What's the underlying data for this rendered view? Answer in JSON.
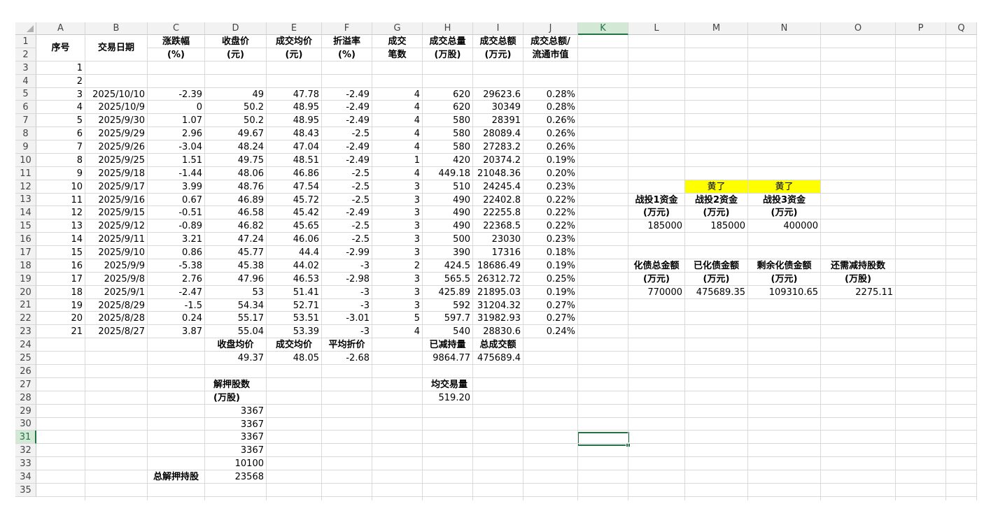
{
  "columns": [
    "A",
    "B",
    "C",
    "D",
    "E",
    "F",
    "G",
    "H",
    "I",
    "J",
    "K",
    "L",
    "M",
    "N",
    "O",
    "P",
    "Q"
  ],
  "selected_column": "K",
  "selected_row": "31",
  "header_row": {
    "A": "序号",
    "B": "交易日期",
    "C1": "涨跌幅",
    "C2": "(%)",
    "D1": "收盘价",
    "D2": "(元)",
    "E1": "成交均价",
    "E2": "(元)",
    "F1": "折溢率",
    "F2": "(%)",
    "G1": "成交",
    "G2": "笔数",
    "H1": "成交总量",
    "H2": "(万股)",
    "I1": "成交总额",
    "I2": "(万元)",
    "J1": "成交总额/",
    "J2": "流通市值"
  },
  "rows": [
    {
      "a": "1",
      "b": "",
      "c": "",
      "d": "",
      "e": "",
      "f": "",
      "g": "",
      "h": "",
      "i": "",
      "j": ""
    },
    {
      "a": "2",
      "b": "",
      "c": "",
      "d": "",
      "e": "",
      "f": "",
      "g": "",
      "h": "",
      "i": "",
      "j": ""
    },
    {
      "a": "3",
      "b": "2025/10/10",
      "c": "-2.39",
      "d": "49",
      "e": "47.78",
      "f": "-2.49",
      "g": "4",
      "h": "620",
      "i": "29623.6",
      "j": "0.28%"
    },
    {
      "a": "4",
      "b": "2025/10/9",
      "c": "0",
      "d": "50.2",
      "e": "48.95",
      "f": "-2.49",
      "g": "4",
      "h": "620",
      "i": "30349",
      "j": "0.28%"
    },
    {
      "a": "5",
      "b": "2025/9/30",
      "c": "1.07",
      "d": "50.2",
      "e": "48.95",
      "f": "-2.49",
      "g": "4",
      "h": "580",
      "i": "28391",
      "j": "0.26%"
    },
    {
      "a": "6",
      "b": "2025/9/29",
      "c": "2.96",
      "d": "49.67",
      "e": "48.43",
      "f": "-2.5",
      "g": "4",
      "h": "580",
      "i": "28089.4",
      "j": "0.26%"
    },
    {
      "a": "7",
      "b": "2025/9/26",
      "c": "-3.04",
      "d": "48.24",
      "e": "47.04",
      "f": "-2.49",
      "g": "4",
      "h": "580",
      "i": "27283.2",
      "j": "0.26%"
    },
    {
      "a": "8",
      "b": "2025/9/25",
      "c": "1.51",
      "d": "49.75",
      "e": "48.51",
      "f": "-2.49",
      "g": "1",
      "h": "420",
      "i": "20374.2",
      "j": "0.19%"
    },
    {
      "a": "9",
      "b": "2025/9/18",
      "c": "-1.44",
      "d": "48.06",
      "e": "46.86",
      "f": "-2.5",
      "g": "4",
      "h": "449.18",
      "i": "21048.36",
      "j": "0.20%"
    },
    {
      "a": "10",
      "b": "2025/9/17",
      "c": "3.99",
      "d": "48.76",
      "e": "47.54",
      "f": "-2.5",
      "g": "3",
      "h": "510",
      "i": "24245.4",
      "j": "0.23%"
    },
    {
      "a": "11",
      "b": "2025/9/16",
      "c": "0.67",
      "d": "46.89",
      "e": "45.72",
      "f": "-2.5",
      "g": "3",
      "h": "490",
      "i": "22402.8",
      "j": "0.22%"
    },
    {
      "a": "12",
      "b": "2025/9/15",
      "c": "-0.51",
      "d": "46.58",
      "e": "45.42",
      "f": "-2.49",
      "g": "3",
      "h": "490",
      "i": "22255.8",
      "j": "0.22%"
    },
    {
      "a": "13",
      "b": "2025/9/12",
      "c": "-0.89",
      "d": "46.82",
      "e": "45.65",
      "f": "-2.5",
      "g": "3",
      "h": "490",
      "i": "22368.5",
      "j": "0.22%"
    },
    {
      "a": "14",
      "b": "2025/9/11",
      "c": "3.21",
      "d": "47.24",
      "e": "46.06",
      "f": "-2.5",
      "g": "3",
      "h": "500",
      "i": "23030",
      "j": "0.23%"
    },
    {
      "a": "15",
      "b": "2025/9/10",
      "c": "0.86",
      "d": "45.77",
      "e": "44.4",
      "f": "-2.99",
      "g": "3",
      "h": "390",
      "i": "17316",
      "j": "0.18%"
    },
    {
      "a": "16",
      "b": "2025/9/9",
      "c": "-5.38",
      "d": "45.38",
      "e": "44.02",
      "f": "-3",
      "g": "2",
      "h": "424.5",
      "i": "18686.49",
      "j": "0.19%"
    },
    {
      "a": "17",
      "b": "2025/9/8",
      "c": "2.76",
      "d": "47.96",
      "e": "46.53",
      "f": "-2.98",
      "g": "3",
      "h": "565.5",
      "i": "26312.72",
      "j": "0.25%"
    },
    {
      "a": "18",
      "b": "2025/9/1",
      "c": "-2.47",
      "d": "53",
      "e": "51.41",
      "f": "-3",
      "g": "3",
      "h": "425.89",
      "i": "21895.03",
      "j": "0.19%"
    },
    {
      "a": "19",
      "b": "2025/8/29",
      "c": "-1.5",
      "d": "54.34",
      "e": "52.71",
      "f": "-3",
      "g": "3",
      "h": "592",
      "i": "31204.32",
      "j": "0.27%"
    },
    {
      "a": "20",
      "b": "2025/8/28",
      "c": "0.24",
      "d": "55.17",
      "e": "53.51",
      "f": "-3.01",
      "g": "5",
      "h": "597.7",
      "i": "31982.93",
      "j": "0.27%"
    },
    {
      "a": "21",
      "b": "2025/8/27",
      "c": "3.87",
      "d": "55.04",
      "e": "53.39",
      "f": "-3",
      "g": "4",
      "h": "540",
      "i": "28830.6",
      "j": "0.24%"
    }
  ],
  "summary": {
    "d24": "收盘均价",
    "e24": "成交均价",
    "f24": "平均折价",
    "h24": "已减持量",
    "i24": "总成交额",
    "d25": "49.37",
    "e25": "48.05",
    "f25": "-2.68",
    "h25": "9864.77",
    "i25": "475689.4",
    "d27": "解押股数",
    "h27": "均交易量",
    "d28": "(万股)",
    "h28": "519.20",
    "d29": "3367",
    "d30": "3367",
    "d31": "3367",
    "d32": "3367",
    "d33": "10100",
    "c34": "总解押持股",
    "d34": "23568"
  },
  "side": {
    "m12": "黄了",
    "n12": "黄了",
    "l13": "战投1资金",
    "m13": "战投2资金",
    "n13": "战投3资金",
    "l14": "(万元)",
    "m14": "(万元)",
    "n14": "(万元)",
    "l15": "185000",
    "m15": "185000",
    "n15": "400000",
    "l18": "化债总金额",
    "m18": "已化债金额",
    "n18": "剩余化债金额",
    "o18": "还需减持股数",
    "l19": "(万元)",
    "m19": "(万元)",
    "n19": "(万元)",
    "o19": "(万股)",
    "l20": "770000",
    "m20": "475689.35",
    "n20": "109310.65",
    "o20": "2275.11"
  },
  "colors": {
    "highlight": "#ffff00",
    "selection": "#217346",
    "grid": "#d9d9d9"
  }
}
